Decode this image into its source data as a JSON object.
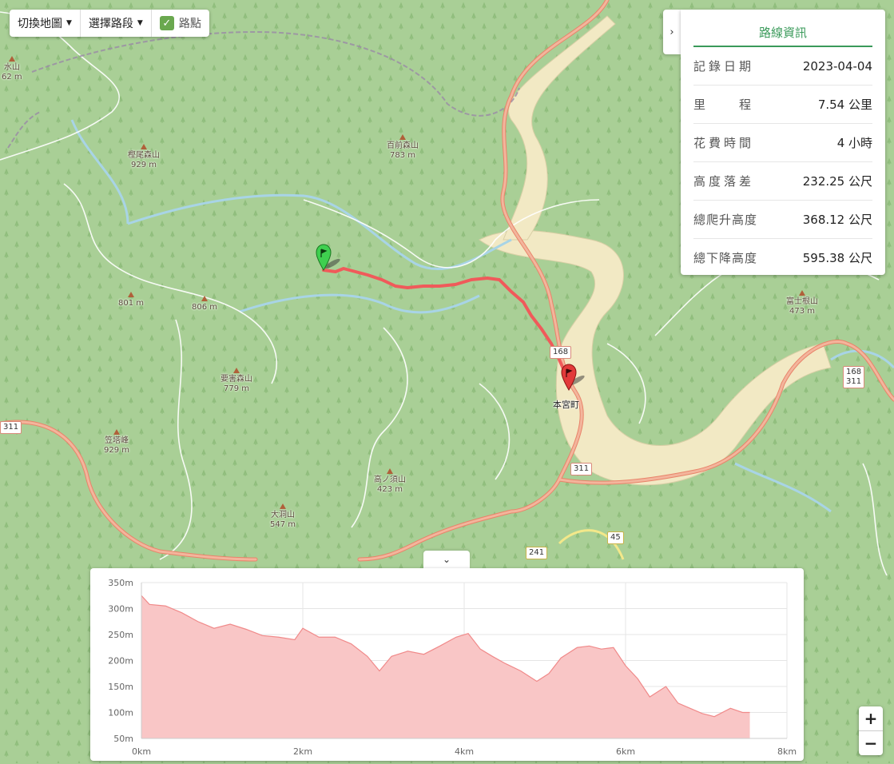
{
  "controls": {
    "switch_map": "切換地圖",
    "select_segment": "選擇路段",
    "waypoints": "路點"
  },
  "info_panel": {
    "title": "路線資訊",
    "rows": [
      {
        "key": "記錄日期",
        "value": "2023-04-04"
      },
      {
        "key": "里　　程",
        "value": "7.54 公里"
      },
      {
        "key": "花費時間",
        "value": "4 小時"
      },
      {
        "key": "高度落差",
        "value": "232.25 公尺"
      },
      {
        "key": "總爬升高度",
        "value": "368.12 公尺"
      },
      {
        "key": "總下降高度",
        "value": "595.38 公尺"
      }
    ]
  },
  "map": {
    "peaks": [
      {
        "name": "樫尾森山",
        "elev": "929 m"
      },
      {
        "name": "百前森山",
        "elev": "783 m"
      },
      {
        "name": "",
        "elev": "801 m"
      },
      {
        "name": "",
        "elev": "806 m"
      },
      {
        "name": "要害森山",
        "elev": "779 m"
      },
      {
        "name": "笠塔峰",
        "elev": "929 m"
      },
      {
        "name": "高ノ須山",
        "elev": "423 m"
      },
      {
        "name": "大洞山",
        "elev": "547 m"
      },
      {
        "name": "富士根山",
        "elev": "473 m"
      },
      {
        "name": "水山",
        "elev": "62 m"
      }
    ],
    "town": "本宮町",
    "road_shields": [
      "168",
      "168",
      "311",
      "311",
      "241",
      "45",
      "311"
    ],
    "colors": {
      "route": "#f05a5a",
      "land": "#a9cf96",
      "river": "#a8d4e6",
      "road": "#f2a488"
    }
  },
  "elevation": {
    "toggle": "⌄",
    "chart_data": {
      "type": "area",
      "x_unit": "km",
      "y_unit": "m",
      "xlim": [
        0,
        8
      ],
      "ylim": [
        50,
        350
      ],
      "xticks": [
        "0km",
        "2km",
        "4km",
        "6km",
        "8km"
      ],
      "yticks": [
        "350m",
        "300m",
        "250m",
        "200m",
        "150m",
        "100m",
        "50m"
      ],
      "x": [
        0,
        0.1,
        0.3,
        0.5,
        0.7,
        0.9,
        1.1,
        1.3,
        1.5,
        1.7,
        1.9,
        2.0,
        2.2,
        2.4,
        2.6,
        2.8,
        2.95,
        3.1,
        3.3,
        3.5,
        3.7,
        3.9,
        4.05,
        4.2,
        4.35,
        4.5,
        4.7,
        4.9,
        5.05,
        5.2,
        5.4,
        5.55,
        5.7,
        5.85,
        6.0,
        6.15,
        6.3,
        6.5,
        6.65,
        6.8,
        6.95,
        7.1,
        7.3,
        7.45,
        7.54
      ],
      "y": [
        325,
        308,
        305,
        292,
        275,
        262,
        270,
        260,
        248,
        245,
        240,
        262,
        245,
        245,
        232,
        208,
        180,
        208,
        218,
        212,
        228,
        245,
        252,
        222,
        208,
        195,
        180,
        160,
        175,
        205,
        225,
        228,
        222,
        225,
        190,
        165,
        130,
        150,
        118,
        108,
        98,
        92,
        108,
        100,
        100
      ],
      "fill": "#f9c6c6",
      "stroke": "#f08a8a"
    }
  },
  "zoom": {
    "in": "+",
    "out": "−"
  }
}
